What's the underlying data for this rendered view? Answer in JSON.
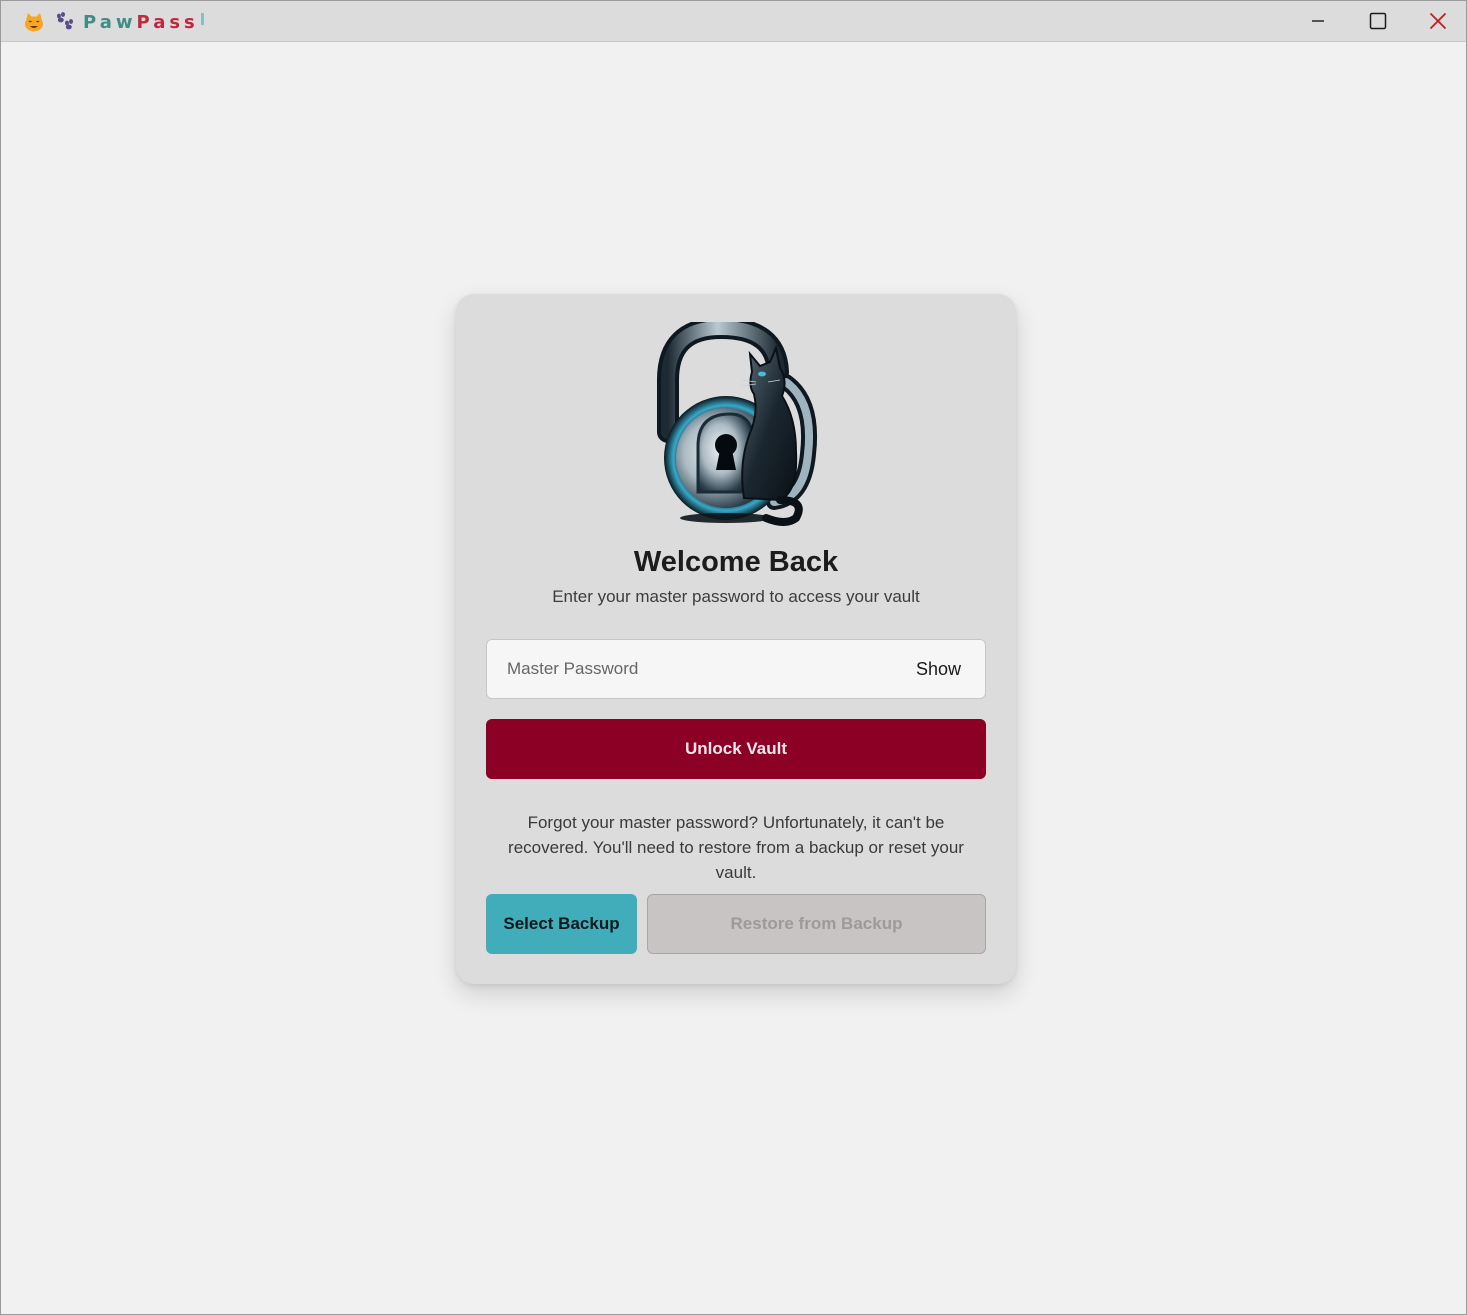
{
  "window": {
    "title_part1": "Paw",
    "title_part2": "Pass",
    "icons": [
      "cat-face-icon",
      "paw-prints-icon"
    ],
    "controls": [
      "minimize-icon",
      "maximize-icon",
      "close-icon"
    ]
  },
  "login": {
    "heading": "Welcome Back",
    "subtitle": "Enter your master password to access your vault",
    "password_placeholder": "Master Password",
    "show_label": "Show",
    "unlock_label": "Unlock Vault",
    "forgot_text": "Forgot your master password? Unfortunately, it can't be recovered. You'll need to restore from a backup or reset your vault.",
    "select_backup_label": "Select Backup",
    "restore_label": "Restore from Backup"
  },
  "colors": {
    "unlock_button": "#8c0025",
    "select_button": "#41adbb",
    "restore_button_disabled": "#c9c4c4",
    "title_paw": "#3f8d86",
    "title_pass": "#c0283e"
  }
}
